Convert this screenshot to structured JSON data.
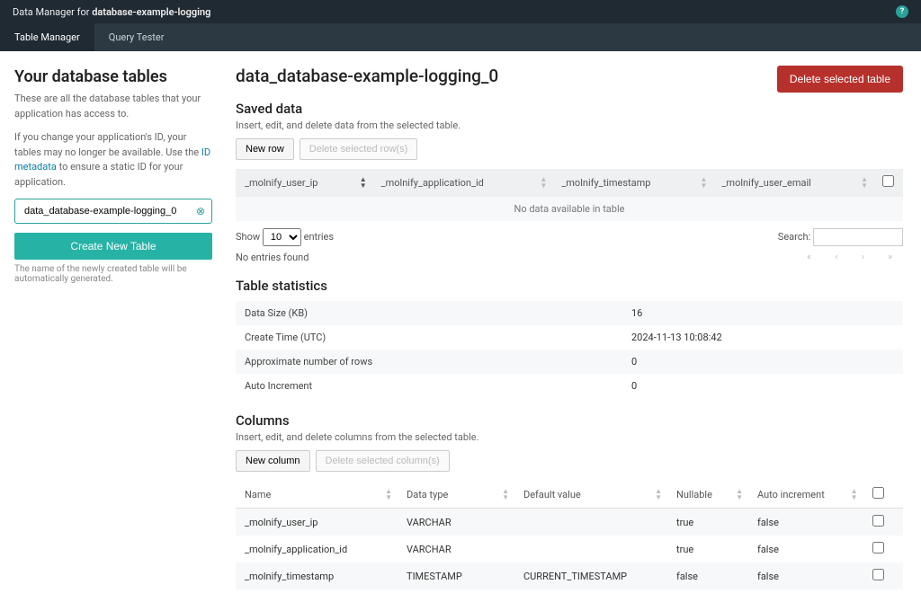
{
  "header": {
    "title_prefix": "Data Manager for",
    "title_name": "database-example-logging"
  },
  "tabs": {
    "manager": "Table Manager",
    "query": "Query Tester"
  },
  "sidebar": {
    "heading": "Your database tables",
    "desc1": "These are all the database tables that your application has access to.",
    "desc2a": "If you change your application's ID, your tables may no longer be available. Use the ",
    "desc2_link": "ID metadata",
    "desc2b": " to ensure a static ID for your application.",
    "selected_table": "data_database-example-logging_0",
    "create_btn": "Create New Table",
    "create_note": "The name of the newly created table will be automatically generated."
  },
  "main": {
    "title": "data_database-example-logging_0",
    "delete_btn": "Delete selected table"
  },
  "saved_data": {
    "title": "Saved data",
    "desc": "Insert, edit, and delete data from the selected table.",
    "new_row": "New row",
    "delete_rows": "Delete selected row(s)",
    "cols": [
      "_molnify_user_ip",
      "_molnify_application_id",
      "_molnify_timestamp",
      "_molnify_user_email"
    ],
    "no_data": "No data available in table",
    "show_label": "Show",
    "entries_label": "entries",
    "page_size": "10",
    "search_label": "Search:",
    "info": "No entries found"
  },
  "stats": {
    "title": "Table statistics",
    "rows": [
      {
        "k": "Data Size (KB)",
        "v": "16"
      },
      {
        "k": "Create Time (UTC)",
        "v": "2024-11-13 10:08:42"
      },
      {
        "k": "Approximate number of rows",
        "v": "0"
      },
      {
        "k": "Auto Increment",
        "v": "0"
      }
    ]
  },
  "columns": {
    "title": "Columns",
    "desc": "Insert, edit, and delete columns from the selected table.",
    "new_col": "New column",
    "delete_cols": "Delete selected column(s)",
    "headers": {
      "name": "Name",
      "type": "Data type",
      "def": "Default value",
      "null": "Nullable",
      "auto": "Auto increment"
    },
    "rows": [
      {
        "name": "_molnify_user_ip",
        "type": "VARCHAR",
        "def": "",
        "null": "true",
        "auto": "false"
      },
      {
        "name": "_molnify_application_id",
        "type": "VARCHAR",
        "def": "",
        "null": "true",
        "auto": "false"
      },
      {
        "name": "_molnify_timestamp",
        "type": "TIMESTAMP",
        "def": "CURRENT_TIMESTAMP",
        "null": "false",
        "auto": "false"
      }
    ]
  }
}
